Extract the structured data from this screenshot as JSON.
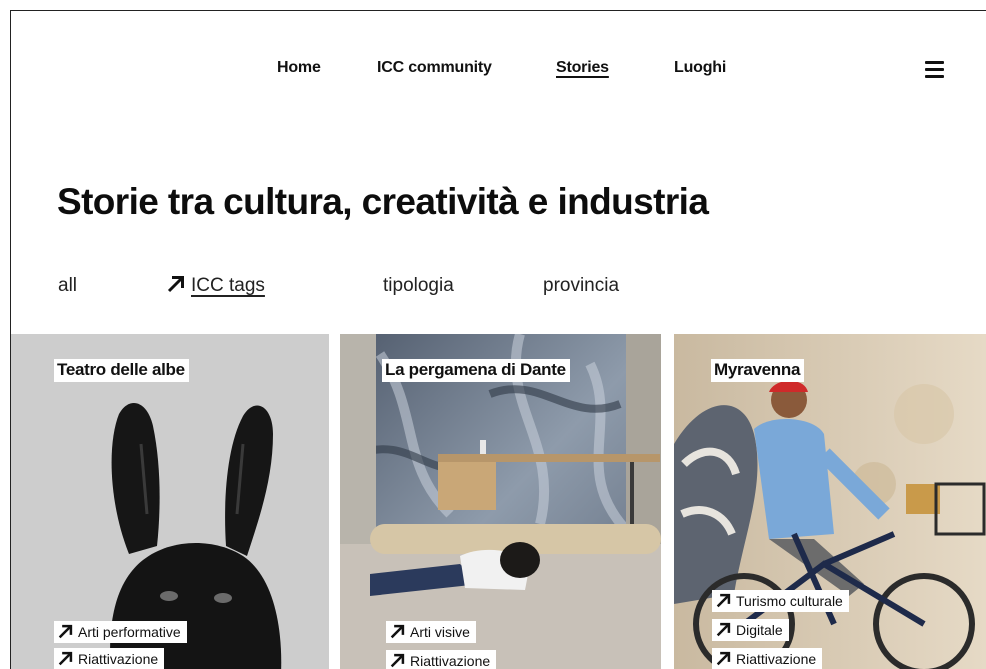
{
  "nav": {
    "items": [
      {
        "label": "Home"
      },
      {
        "label": "ICC community"
      },
      {
        "label": "Stories"
      },
      {
        "label": "Luoghi"
      }
    ],
    "menu_icon": "hamburger-menu-icon"
  },
  "page": {
    "title": "Storie tra cultura, creatività e industria"
  },
  "filters": {
    "all": "all",
    "icc_tags": "ICC tags",
    "tipologia": "tipologia",
    "provincia": "provincia"
  },
  "cards": [
    {
      "title": "Teatro delle albe",
      "tags": [
        "Arti performative",
        "Riattivazione"
      ]
    },
    {
      "title": "La pergamena di Dante",
      "tags": [
        "Arti visive",
        "Riattivazione"
      ]
    },
    {
      "title": "Myravenna",
      "tags": [
        "Turismo culturale",
        "Digitale",
        "Riattivazione"
      ]
    }
  ],
  "colors": {
    "text": "#111111",
    "background": "#ffffff",
    "card1_bg": "#cdcdcd",
    "card2_bg": "#6d7785",
    "card3_bg": "#d8cbb4"
  }
}
